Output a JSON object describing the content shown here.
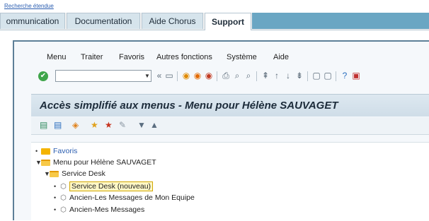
{
  "top_link": "Recherche étendue",
  "tabs": [
    {
      "label": "ommunication"
    },
    {
      "label": "Documentation"
    },
    {
      "label": "Aide Chorus"
    },
    {
      "label": "Support",
      "active": true
    }
  ],
  "menubar": {
    "items": [
      "Menu",
      "Traiter",
      "Favoris",
      "Autres fonctions",
      "Système",
      "Aide"
    ]
  },
  "toolbar": {
    "command_value": "",
    "icons": [
      "ok-icon",
      "back-icon",
      "save-icon",
      "exit-icon",
      "cancel-icon",
      "print-icon",
      "find-icon",
      "find-next-icon",
      "page-icons",
      "layout-icon",
      "help-icon",
      "customize-icon"
    ]
  },
  "title": "Accès simplifié aux menus  -  Menu pour Hélène SAUVAGET",
  "tree": {
    "favoris": "Favoris",
    "menu_root": "Menu pour Hélène SAUVAGET",
    "service_desk_folder": "Service Desk",
    "items": [
      "Service Desk (nouveau)",
      "Ancien-Les Messages de Mon Equipe",
      "Ancien-Mes Messages"
    ]
  }
}
